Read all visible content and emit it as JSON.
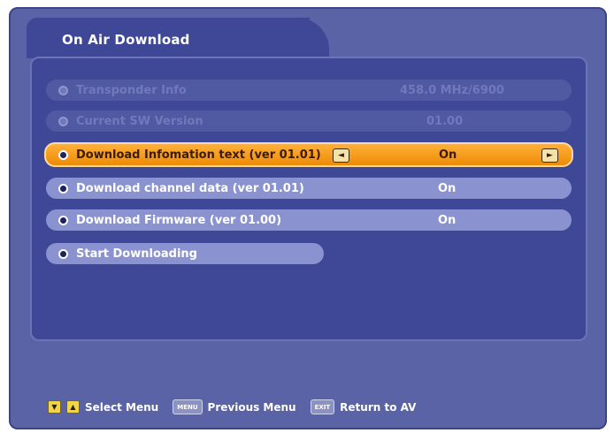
{
  "window": {
    "title": "On Air Download"
  },
  "menu": {
    "items": [
      {
        "label": "Transponder Info",
        "value": "458.0 MHz/6900",
        "state": "disabled"
      },
      {
        "label": "Current SW Version",
        "value": "01.00",
        "state": "disabled"
      },
      {
        "label": "Download Infomation text (ver 01.01)",
        "value": "On",
        "state": "selected"
      },
      {
        "label": "Download channel data (ver 01.01)",
        "value": "On",
        "state": "normal"
      },
      {
        "label": "Download Firmware (ver 01.00)",
        "value": "On",
        "state": "normal"
      },
      {
        "label": "Start Downloading",
        "value": "",
        "state": "normal"
      }
    ],
    "left_arrow": "◄",
    "right_arrow": "►"
  },
  "footer": {
    "select_keys": [
      "▼",
      "▲"
    ],
    "select_label": "Select Menu",
    "menu_key": "MENU",
    "previous_label": "Previous Menu",
    "exit_key": "EXIT",
    "return_label": "Return to AV"
  },
  "colors": {
    "background": "#5963a6",
    "panel": "#3e4896",
    "highlight": "#f29a1a",
    "item": "#8a93d0"
  }
}
